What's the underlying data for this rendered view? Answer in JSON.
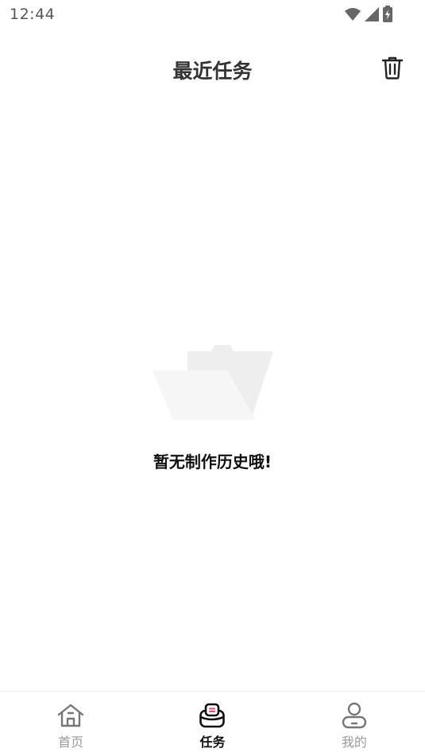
{
  "status_bar": {
    "time": "12:44"
  },
  "header": {
    "title": "最近任务",
    "delete_icon": "trash-icon"
  },
  "empty_state": {
    "illustration": "folder-icon",
    "message": "暂无制作历史哦!"
  },
  "bottom_nav": {
    "items": [
      {
        "label": "首页",
        "icon": "home-icon",
        "active": false
      },
      {
        "label": "任务",
        "icon": "task-icon",
        "active": true
      },
      {
        "label": "我的",
        "icon": "profile-icon",
        "active": false
      }
    ]
  },
  "colors": {
    "accent": "#f0446a",
    "active_text": "#111111",
    "inactive_text": "#999999",
    "title_text": "#333333"
  }
}
